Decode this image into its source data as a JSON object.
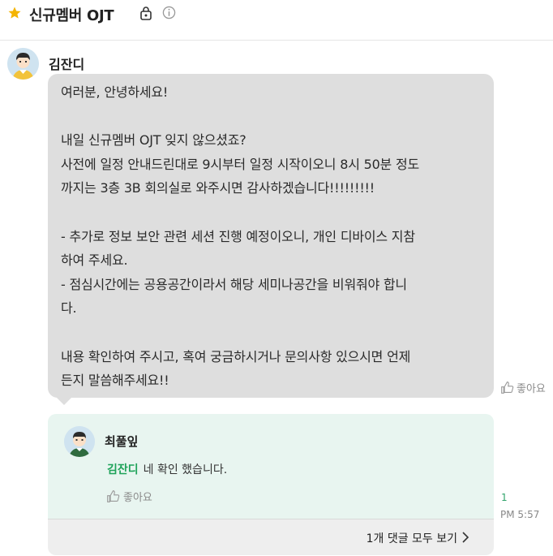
{
  "header": {
    "title": "신규멤버 OJT",
    "star_color": "#f4b400"
  },
  "post": {
    "sender": "김잔디",
    "lines": [
      "여러분, 안녕하세요!",
      "",
      "내일 신규멤버 OJT 잊지 않으셨죠?",
      "사전에 일정 안내드린대로 9시부터 일정 시작이오니 8시 50분 정도",
      "까지는 3층 3B 회의실로 와주시면 감사하겠습니다!!!!!!!!!",
      "",
      "- 추가로 정보 보안 관련 세션 진행 예정이오니, 개인 디바이스 지참",
      "하여 주세요.",
      "- 점심시간에는 공용공간이라서 해당 세미나공간을 비워줘야 합니",
      "다.",
      "",
      "내용 확인하여 주시고, 혹여 궁금하시거나 문의사항 있으시면 언제",
      "든지 말씀해주세요!!"
    ],
    "like_label": "좋아요",
    "reply_count": "1",
    "time": "PM 5:57"
  },
  "reply": {
    "author": "최풀잎",
    "mention": "김잔디",
    "text": "네 확인 했습니다.",
    "like_label": "좋아요"
  },
  "thread": {
    "view_all_label": "1개 댓글 모두 보기"
  }
}
